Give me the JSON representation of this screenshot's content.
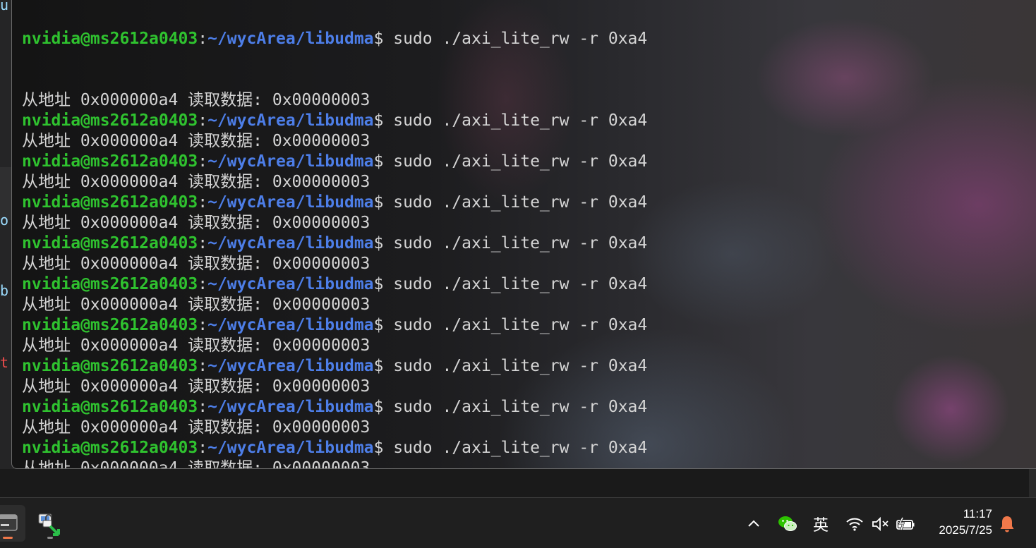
{
  "terminal": {
    "partial_top_prompt": {
      "user_host": "nvidia@ms2612a0403",
      "colon": ":",
      "path": "~/wycArea/libudma",
      "dollar": "$",
      "command": " sudo ./axi_lite_rw -r 0xa4"
    },
    "output_text": "从地址 0x000000a4 读取数据: 0x00000003",
    "prompt": {
      "user_host": "nvidia@ms2612a0403",
      "colon": ":",
      "path": "~/wycArea/libudma",
      "dollar": "$",
      "command": " sudo ./axi_lite_rw -r 0xa4"
    },
    "line_pairs": [
      {
        "output": "从地址 0x000000a4 读取数据: 0x00000003",
        "command": " sudo ./axi_lite_rw -r 0xa4"
      },
      {
        "output": "从地址 0x000000a4 读取数据: 0x00000003",
        "command": " sudo ./axi_lite_rw -r 0xa4"
      },
      {
        "output": "从地址 0x000000a4 读取数据: 0x00000003",
        "command": " sudo ./axi_lite_rw -r 0xa4"
      },
      {
        "output": "从地址 0x000000a4 读取数据: 0x00000003",
        "command": " sudo ./axi_lite_rw -r 0xa4"
      },
      {
        "output": "从地址 0x000000a4 读取数据: 0x00000003",
        "command": " sudo ./axi_lite_rw -r 0xa4"
      },
      {
        "output": "从地址 0x000000a4 读取数据: 0x00000003",
        "command": " sudo ./axi_lite_rw -r 0xa4"
      },
      {
        "output": "从地址 0x000000a4 读取数据: 0x00000003",
        "command": " sudo ./axi_lite_rw -r 0xa4"
      },
      {
        "output": "从地址 0x000000a4 读取数据: 0x00000003",
        "command": " sudo ./axi_lite_rw -r 0xa4"
      },
      {
        "output": "从地址 0x000000a4 读取数据: 0x00000003",
        "command": " sudo ./axi_lite_rw -r 0xa4"
      },
      {
        "output": "从地址 0x000000a4 读取数据: 0x00000003",
        "command": " sudo ./axi_lite_rw -r 0xa4"
      },
      {
        "output": "从地址 0x000000a4 读取数据: 0x00000003",
        "command": " sudo ./axi_lite_rw -r 0xa4"
      }
    ],
    "colors": {
      "user_host": "#2fc22f",
      "path": "#4d7ee8",
      "text": "#d4d4d4"
    }
  },
  "background_editor": {
    "fragments": [
      {
        "text": "u",
        "color": "#9cdcfe"
      },
      {
        "text": "o",
        "color": "#9cdcfe"
      },
      {
        "text": "b",
        "color": "#9cdcfe"
      },
      {
        "text": "t",
        "color": "#f14c4c"
      }
    ]
  },
  "taskbar": {
    "apps": [
      {
        "name": "terminal-app",
        "icon": "terminal-icon",
        "active": true,
        "indicator_color": "#f0784a"
      },
      {
        "name": "network-tool-app",
        "icon": "network-share-icon",
        "active": false,
        "indicator_color": "#8a8a8a"
      }
    ],
    "tray": {
      "show_hidden_icon": "chevron-up-icon",
      "wechat_icon": "wechat-icon",
      "ime_label": "英",
      "wifi_icon": "wifi-icon",
      "volume_icon": "volume-muted-icon",
      "battery_icon": "battery-charging-icon",
      "time": "11:17",
      "date": "2025/7/25",
      "notification_icon": "bell-icon",
      "notification_color": "#f0784a"
    }
  }
}
